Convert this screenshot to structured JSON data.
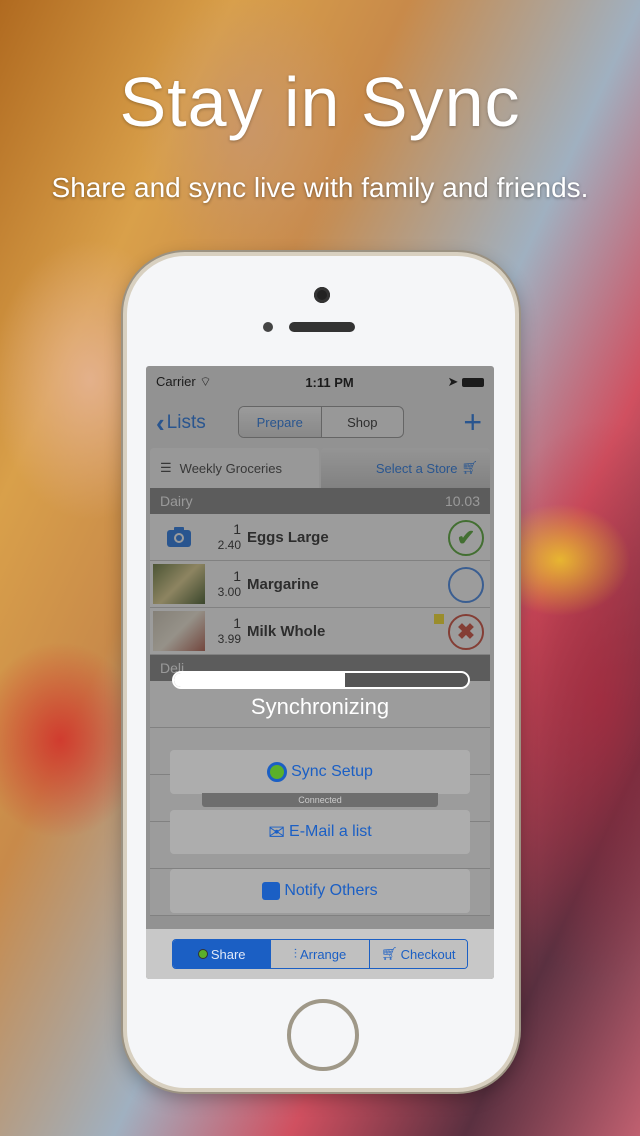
{
  "promo": {
    "headline": "Stay in Sync",
    "subline": "Share and sync live with family and friends."
  },
  "status_bar": {
    "carrier": "Carrier",
    "time": "1:11 PM"
  },
  "nav": {
    "back_label": "Lists",
    "segments": [
      "Prepare",
      "Shop"
    ],
    "active_segment": "Prepare",
    "add_icon": "plus-icon"
  },
  "list_tabs": {
    "list_name": "Weekly Groceries",
    "store_label": "Select a Store"
  },
  "sections": [
    {
      "name": "Dairy",
      "total": "10.03",
      "items": [
        {
          "qty": "1",
          "price": "2.40",
          "name": "Eggs Large",
          "status": "checked",
          "thumb": "camera-icon"
        },
        {
          "qty": "1",
          "price": "3.00",
          "name": "Margarine",
          "status": "unchecked",
          "thumb": "photo"
        },
        {
          "qty": "1",
          "price": "3.99",
          "name": "Milk Whole",
          "status": "unavailable",
          "thumb": "photo",
          "has_note": true
        }
      ]
    },
    {
      "name": "Deli",
      "total": "",
      "items": []
    }
  ],
  "sync": {
    "label": "Synchronizing",
    "progress": 0.58,
    "connected_label": "Connected"
  },
  "actions": [
    {
      "label": "Sync Setup",
      "icon": "sync-icon"
    },
    {
      "label": "E-Mail a list",
      "icon": "email-icon"
    },
    {
      "label": "Notify Others",
      "icon": "notify-icon"
    }
  ],
  "bottom_bar": {
    "items": [
      "Share",
      "Arrange",
      "Checkout"
    ],
    "active": "Share"
  },
  "colors": {
    "accent": "#1b6bd4",
    "check_green": "#4a9a2a",
    "x_red": "#c04030"
  }
}
